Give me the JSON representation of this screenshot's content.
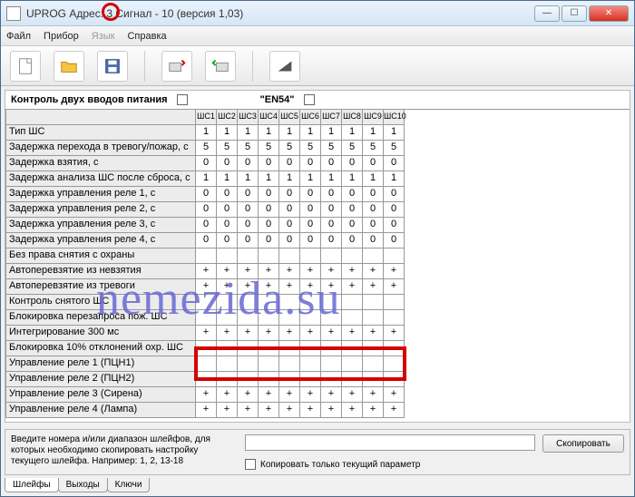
{
  "window": {
    "title": "UPROG   Адрес: 3   Сигнал - 10 (версия  1,03)"
  },
  "menu": {
    "file": "Файл",
    "device": "Прибор",
    "lang": "Язык",
    "help": "Справка"
  },
  "header": {
    "label1": "Контроль двух вводов питания",
    "label2": "\"EN54\""
  },
  "cols": [
    "ШС1",
    "ШС2",
    "ШС3",
    "ШС4",
    "ШС5",
    "ШС6",
    "ШС7",
    "ШС8",
    "ШС9",
    "ШС10"
  ],
  "rows": [
    {
      "name": "Тип ШС",
      "v": [
        "1",
        "1",
        "1",
        "1",
        "1",
        "1",
        "1",
        "1",
        "1",
        "1"
      ]
    },
    {
      "name": "Задержка перехода в тревогу/пожар, с",
      "v": [
        "5",
        "5",
        "5",
        "5",
        "5",
        "5",
        "5",
        "5",
        "5",
        "5"
      ]
    },
    {
      "name": "Задержка взятия, с",
      "v": [
        "0",
        "0",
        "0",
        "0",
        "0",
        "0",
        "0",
        "0",
        "0",
        "0"
      ]
    },
    {
      "name": "Задержка анализа ШС после сброса, с",
      "v": [
        "1",
        "1",
        "1",
        "1",
        "1",
        "1",
        "1",
        "1",
        "1",
        "1"
      ]
    },
    {
      "name": "Задержка управления реле 1, с",
      "v": [
        "0",
        "0",
        "0",
        "0",
        "0",
        "0",
        "0",
        "0",
        "0",
        "0"
      ]
    },
    {
      "name": "Задержка управления реле 2, с",
      "v": [
        "0",
        "0",
        "0",
        "0",
        "0",
        "0",
        "0",
        "0",
        "0",
        "0"
      ]
    },
    {
      "name": "Задержка управления реле 3, с",
      "v": [
        "0",
        "0",
        "0",
        "0",
        "0",
        "0",
        "0",
        "0",
        "0",
        "0"
      ]
    },
    {
      "name": "Задержка управления реле 4, с",
      "v": [
        "0",
        "0",
        "0",
        "0",
        "0",
        "0",
        "0",
        "0",
        "0",
        "0"
      ]
    },
    {
      "name": "Без права снятия с охраны",
      "v": [
        "",
        "",
        "",
        "",
        "",
        "",
        "",
        "",
        "",
        ""
      ]
    },
    {
      "name": "Автоперевзятие из невзятия",
      "v": [
        "+",
        "+",
        "+",
        "+",
        "+",
        "+",
        "+",
        "+",
        "+",
        "+"
      ]
    },
    {
      "name": "Автоперевзятие из тревоги",
      "v": [
        "+",
        "+",
        "+",
        "+",
        "+",
        "+",
        "+",
        "+",
        "+",
        "+"
      ]
    },
    {
      "name": "Контроль снятого ШС",
      "v": [
        "",
        "",
        "",
        "",
        "",
        "",
        "",
        "",
        "",
        ""
      ]
    },
    {
      "name": "Блокировка перезапроса пож. ШС",
      "v": [
        "",
        "",
        "",
        "",
        "",
        "",
        "",
        "",
        "",
        ""
      ]
    },
    {
      "name": "Интегрирование 300 мс",
      "v": [
        "+",
        "+",
        "+",
        "+",
        "+",
        "+",
        "+",
        "+",
        "+",
        "+"
      ]
    },
    {
      "name": "Блокировка 10% отклонений охр. ШС",
      "v": [
        "-",
        "-",
        "-",
        "-",
        "-",
        "-",
        "-",
        "-",
        "-",
        "-"
      ]
    },
    {
      "name": "Управление реле 1 (ПЦН1)",
      "v": [
        "",
        "",
        "",
        "",
        "",
        "",
        "",
        "",
        "",
        ""
      ]
    },
    {
      "name": "Управление реле 2 (ПЦН2)",
      "v": [
        "",
        "",
        "",
        "",
        "",
        "",
        "",
        "",
        "",
        ""
      ]
    },
    {
      "name": "Управление реле 3 (Сирена)",
      "v": [
        "+",
        "+",
        "+",
        "+",
        "+",
        "+",
        "+",
        "+",
        "+",
        "+"
      ]
    },
    {
      "name": "Управление реле 4 (Лампа)",
      "v": [
        "+",
        "+",
        "+",
        "+",
        "+",
        "+",
        "+",
        "+",
        "+",
        "+"
      ]
    }
  ],
  "bottom": {
    "hint": "Введите номера и/или диапазон шлейфов, для которых необходимо скопировать настройку текущего шлейфа. Например: 1, 2, 13-18",
    "copy": "Скопировать",
    "copyonly": "Копировать только текущий параметр"
  },
  "tabs": {
    "t1": "Шлейфы",
    "t2": "Выходы",
    "t3": "Ключи"
  },
  "watermark": "nemezida.su"
}
